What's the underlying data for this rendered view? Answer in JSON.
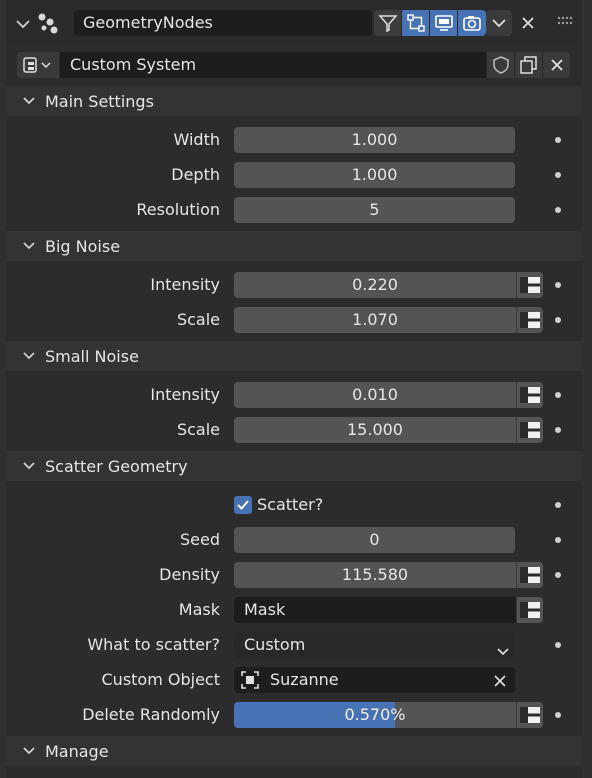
{
  "header": {
    "modifier_name": "GeometryNodes",
    "icons": [
      "collapse-chevron-icon",
      "geometry-nodes-icon",
      "node-tree-icon",
      "edit-mode-icon",
      "viewport-icon",
      "render-icon",
      "dropdown-icon",
      "close-icon",
      "drag-handle-icon"
    ]
  },
  "node_group": {
    "name": "Custom System"
  },
  "sections": {
    "main": "Main Settings",
    "big_noise": "Big Noise",
    "small_noise": "Small Noise",
    "scatter": "Scatter Geometry",
    "manage": "Manage"
  },
  "main": {
    "width_label": "Width",
    "width_value": "1.000",
    "depth_label": "Depth",
    "depth_value": "1.000",
    "resolution_label": "Resolution",
    "resolution_value": "5"
  },
  "big_noise": {
    "intensity_label": "Intensity",
    "intensity_value": "0.220",
    "scale_label": "Scale",
    "scale_value": "1.070"
  },
  "small_noise": {
    "intensity_label": "Intensity",
    "intensity_value": "0.010",
    "scale_label": "Scale",
    "scale_value": "15.000"
  },
  "scatter": {
    "scatter_label": "Scatter?",
    "scatter_checked": true,
    "seed_label": "Seed",
    "seed_value": "0",
    "density_label": "Density",
    "density_value": "115.580",
    "mask_label": "Mask",
    "mask_value": "Mask",
    "what_label": "What to scatter?",
    "what_value": "Custom",
    "object_label": "Custom Object",
    "object_value": "Suzanne",
    "delete_label": "Delete Randomly",
    "delete_value": "0.570%",
    "delete_fraction": 0.57
  },
  "colors": {
    "accent": "#4772b3",
    "panel": "#2c2c2c",
    "field": "#545454"
  }
}
